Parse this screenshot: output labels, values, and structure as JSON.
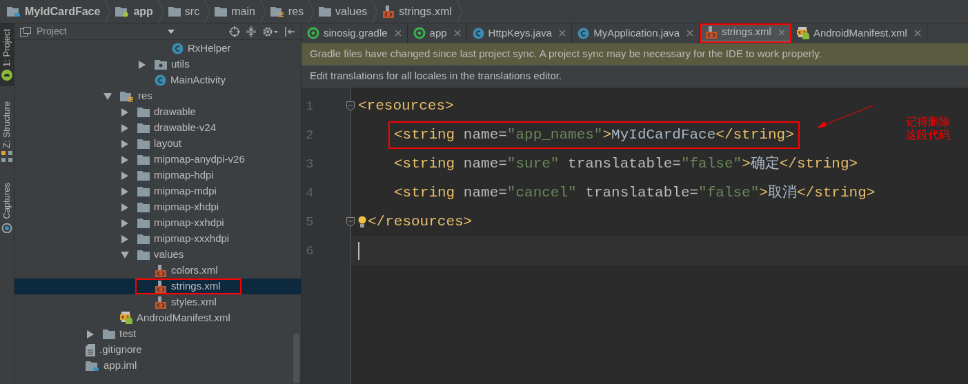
{
  "breadcrumbs": [
    {
      "label": "MyIdCardFace",
      "kind": "module",
      "bold": true
    },
    {
      "label": "app",
      "kind": "app",
      "bold": true
    },
    {
      "label": "src",
      "kind": "folder",
      "bold": false
    },
    {
      "label": "main",
      "kind": "folder",
      "bold": false
    },
    {
      "label": "res",
      "kind": "res",
      "bold": false
    },
    {
      "label": "values",
      "kind": "folder",
      "bold": false
    },
    {
      "label": "strings.xml",
      "kind": "xml",
      "bold": false
    }
  ],
  "tool_strip": [
    {
      "label": "1: Project",
      "kind": "android",
      "selected": true
    },
    {
      "label": "Z: Structure",
      "kind": "structure",
      "selected": false
    },
    {
      "label": "Captures",
      "kind": "captures",
      "selected": false
    }
  ],
  "project_panel": {
    "title": "Project",
    "tree": [
      {
        "children": [
          {
            "children": [
              {
                "children": [
                  {
                    "children": [
                      {
                        "children": [
                          {
                            "label": "RxHelper",
                            "kind": "class",
                            "selected": false,
                            "boxed": false
                          }
                        ]
                      },
                      {
                        "label": "utils",
                        "kind": "package",
                        "expanded": false,
                        "selected": false,
                        "boxed": false
                      },
                      {
                        "label": "MainActivity",
                        "kind": "class",
                        "selected": false,
                        "boxed": false
                      }
                    ]
                  }
                ]
              },
              {
                "label": "res",
                "kind": "res",
                "expanded": true,
                "selected": false,
                "boxed": false,
                "children": [
                  {
                    "label": "drawable",
                    "kind": "folder",
                    "expanded": false,
                    "selected": false,
                    "boxed": false
                  },
                  {
                    "label": "drawable-v24",
                    "kind": "folder",
                    "expanded": false,
                    "selected": false,
                    "boxed": false
                  },
                  {
                    "label": "layout",
                    "kind": "folder",
                    "expanded": false,
                    "selected": false,
                    "boxed": false
                  },
                  {
                    "label": "mipmap-anydpi-v26",
                    "kind": "folder",
                    "expanded": false,
                    "selected": false,
                    "boxed": false
                  },
                  {
                    "label": "mipmap-hdpi",
                    "kind": "folder",
                    "expanded": false,
                    "selected": false,
                    "boxed": false
                  },
                  {
                    "label": "mipmap-mdpi",
                    "kind": "folder",
                    "expanded": false,
                    "selected": false,
                    "boxed": false
                  },
                  {
                    "label": "mipmap-xhdpi",
                    "kind": "folder",
                    "expanded": false,
                    "selected": false,
                    "boxed": false
                  },
                  {
                    "label": "mipmap-xxhdpi",
                    "kind": "folder",
                    "expanded": false,
                    "selected": false,
                    "boxed": false
                  },
                  {
                    "label": "mipmap-xxxhdpi",
                    "kind": "folder",
                    "expanded": false,
                    "selected": false,
                    "boxed": false
                  },
                  {
                    "label": "values",
                    "kind": "folder",
                    "expanded": true,
                    "selected": false,
                    "boxed": false,
                    "children": [
                      {
                        "label": "colors.xml",
                        "kind": "xml",
                        "selected": false,
                        "boxed": false
                      },
                      {
                        "label": "strings.xml",
                        "kind": "xml",
                        "selected": true,
                        "boxed": true
                      },
                      {
                        "label": "styles.xml",
                        "kind": "xml",
                        "selected": false,
                        "boxed": false
                      }
                    ]
                  }
                ]
              },
              {
                "label": "AndroidManifest.xml",
                "kind": "manifest",
                "selected": false,
                "boxed": false
              }
            ]
          },
          {
            "label": "test",
            "kind": "folder",
            "expanded": false,
            "selected": false,
            "boxed": false
          }
        ]
      },
      {
        "label": ".gitignore",
        "kind": "file",
        "selected": false,
        "boxed": false
      },
      {
        "label": "app.iml",
        "kind": "module",
        "selected": false,
        "boxed": false
      }
    ]
  },
  "tabs": [
    {
      "label": "sinosig.gradle",
      "kind": "gradle",
      "selected": false,
      "boxed": false
    },
    {
      "label": "app",
      "kind": "gradle",
      "selected": false,
      "boxed": false
    },
    {
      "label": "HttpKeys.java",
      "kind": "class",
      "selected": false,
      "boxed": false
    },
    {
      "label": "MyApplication.java",
      "kind": "class",
      "selected": false,
      "boxed": false
    },
    {
      "label": "strings.xml",
      "kind": "xml",
      "selected": true,
      "boxed": true
    },
    {
      "label": "AndroidManifest.xml",
      "kind": "manifest",
      "selected": false,
      "boxed": false
    }
  ],
  "notifications": [
    {
      "kind": "warning",
      "text": "Gradle files have changed since last project sync. A project sync may be necessary for the IDE to work properly."
    },
    {
      "kind": "info",
      "text": "Edit translations for all locales in the translations editor."
    }
  ],
  "code_lines": [
    {
      "number": "1",
      "indented": false,
      "fold": true,
      "bulb": false,
      "current": false,
      "tokens": [
        {
          "kind": "tag",
          "text": "<resources>"
        }
      ]
    },
    {
      "number": "2",
      "indented": true,
      "fold": false,
      "bulb": false,
      "current": false,
      "boxed": true,
      "tokens": [
        {
          "kind": "tag",
          "text": "<string "
        },
        {
          "kind": "attr",
          "text": "name="
        },
        {
          "kind": "value",
          "text": "\"app_names\""
        },
        {
          "kind": "tag",
          "text": ">"
        },
        {
          "kind": "text",
          "text": "MyIdCardFace"
        },
        {
          "kind": "tag",
          "text": "</string>"
        }
      ]
    },
    {
      "number": "3",
      "indented": true,
      "fold": false,
      "bulb": false,
      "current": false,
      "tokens": [
        {
          "kind": "tag",
          "text": "<string "
        },
        {
          "kind": "attr",
          "text": "name="
        },
        {
          "kind": "value",
          "text": "\"sure\""
        },
        {
          "kind": "attr",
          "text": " translatable="
        },
        {
          "kind": "value",
          "text": "\"false\""
        },
        {
          "kind": "tag",
          "text": ">"
        },
        {
          "kind": "text",
          "text": "确定"
        },
        {
          "kind": "tag",
          "text": "</string>"
        }
      ]
    },
    {
      "number": "4",
      "indented": true,
      "fold": false,
      "bulb": false,
      "current": false,
      "tokens": [
        {
          "kind": "tag",
          "text": "<string "
        },
        {
          "kind": "attr",
          "text": "name="
        },
        {
          "kind": "value",
          "text": "\"cancel\""
        },
        {
          "kind": "attr",
          "text": " translatable="
        },
        {
          "kind": "value",
          "text": "\"false\""
        },
        {
          "kind": "tag",
          "text": ">"
        },
        {
          "kind": "text",
          "text": "取消"
        },
        {
          "kind": "tag",
          "text": "</string>"
        }
      ]
    },
    {
      "number": "5",
      "indented": false,
      "fold": true,
      "bulb": true,
      "current": false,
      "tokens": [
        {
          "kind": "tag",
          "text": "</resources>"
        }
      ]
    },
    {
      "number": "6",
      "indented": false,
      "fold": false,
      "bulb": false,
      "current": true
    }
  ],
  "annotation": {
    "lines": [
      "记得删除",
      "这段代码"
    ]
  }
}
